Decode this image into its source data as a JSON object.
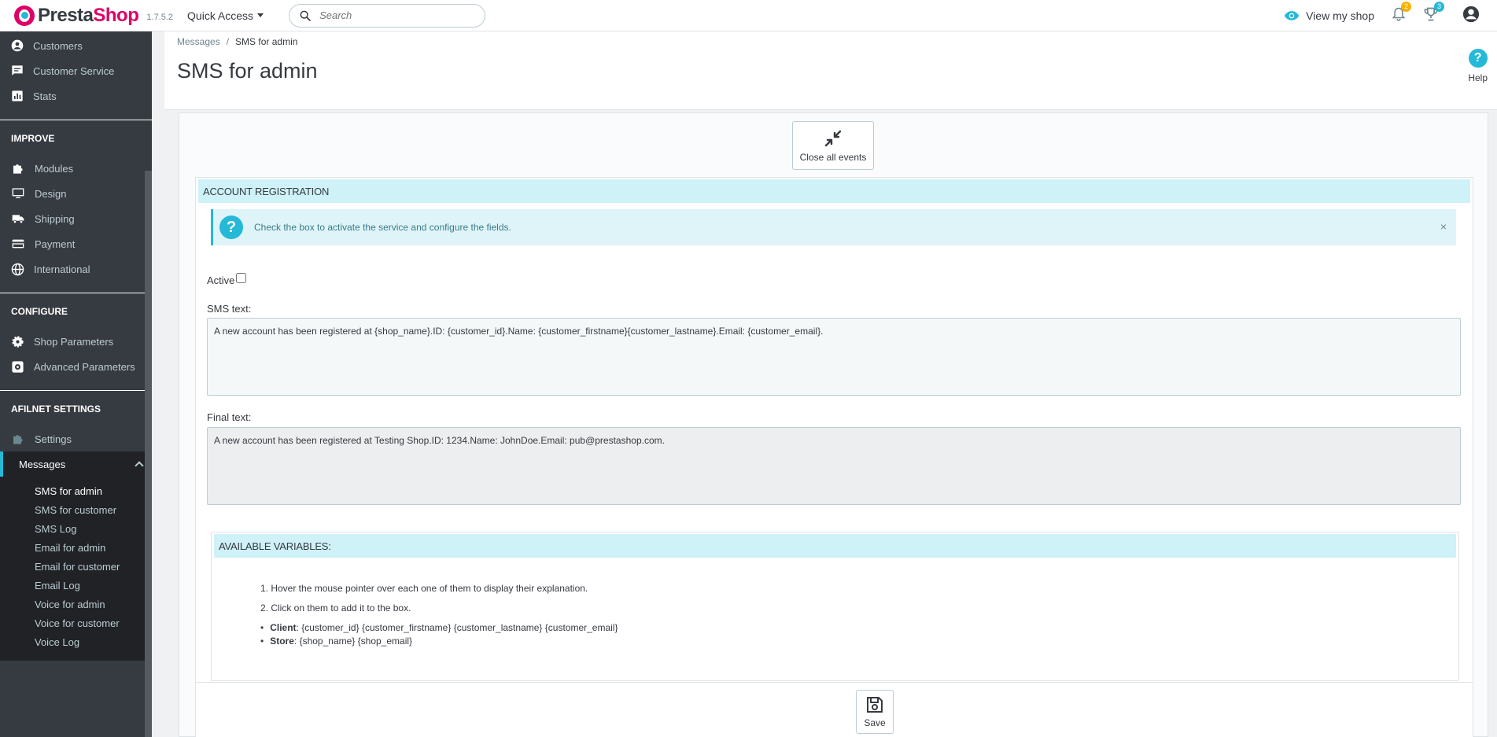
{
  "header": {
    "logo_brand": "Presta",
    "logo_brand2": "Shop",
    "version": "1.7.5.2",
    "quick_access": "Quick Access",
    "search_placeholder": "Search",
    "view_shop": "View my shop",
    "notif_orders_count": "2",
    "notif_customers_count": "3"
  },
  "sidebar": {
    "items_top": [
      {
        "label": "Customers",
        "icon": "account-circle-icon"
      },
      {
        "label": "Customer Service",
        "icon": "chat-icon"
      },
      {
        "label": "Stats",
        "icon": "bar-chart-icon"
      }
    ],
    "improve_title": "IMPROVE",
    "improve": [
      {
        "label": "Modules",
        "icon": "puzzle-icon"
      },
      {
        "label": "Design",
        "icon": "desktop-icon"
      },
      {
        "label": "Shipping",
        "icon": "truck-icon"
      },
      {
        "label": "Payment",
        "icon": "credit-card-icon"
      },
      {
        "label": "International",
        "icon": "globe-icon"
      }
    ],
    "configure_title": "CONFIGURE",
    "configure": [
      {
        "label": "Shop Parameters",
        "icon": "gear-icon"
      },
      {
        "label": "Advanced Parameters",
        "icon": "settings-box-icon"
      }
    ],
    "afilnet_title": "AFILNET SETTINGS",
    "afilnet_settings": "Settings",
    "messages": "Messages",
    "submenu": [
      "SMS for admin",
      "SMS for customer",
      "SMS Log",
      "Email for admin",
      "Email for customer",
      "Email Log",
      "Voice for admin",
      "Voice for customer",
      "Voice Log"
    ]
  },
  "page": {
    "breadcrumb_parent": "Messages",
    "breadcrumb_sep": "/",
    "breadcrumb_current": "SMS for admin",
    "title": "SMS for admin",
    "help": "Help"
  },
  "form": {
    "close_events": "Close all events",
    "section_title": "ACCOUNT REGISTRATION",
    "alert_text": "Check the box to activate the service and configure the fields.",
    "alert_close": "×",
    "active_label": "Active",
    "sms_text_label": "SMS text:",
    "sms_text_value": "A new account has been registered at {shop_name}.ID: {customer_id}.Name: {customer_firstname}{customer_lastname}.Email: {customer_email}.",
    "final_text_label": "Final text:",
    "final_text_value": "A new account has been registered at Testing Shop.ID: 1234.Name: JohnDoe.Email: pub@prestashop.com.",
    "vars_title": "AVAILABLE VARIABLES:",
    "instructions": [
      "1. Hover the mouse pointer over each one of them to display their explanation.",
      "2. Click on them to add it to the box."
    ],
    "client_label": "Client",
    "client_vars": [
      "{customer_id}",
      "{customer_firstname}",
      "{customer_lastname}",
      "{customer_email}"
    ],
    "store_label": "Store",
    "store_vars": [
      "{shop_name}",
      "{shop_email}"
    ],
    "save": "Save"
  },
  "colors": {
    "accent": "#25b9d7",
    "brand": "#df0067",
    "sidebar": "#363a41"
  }
}
